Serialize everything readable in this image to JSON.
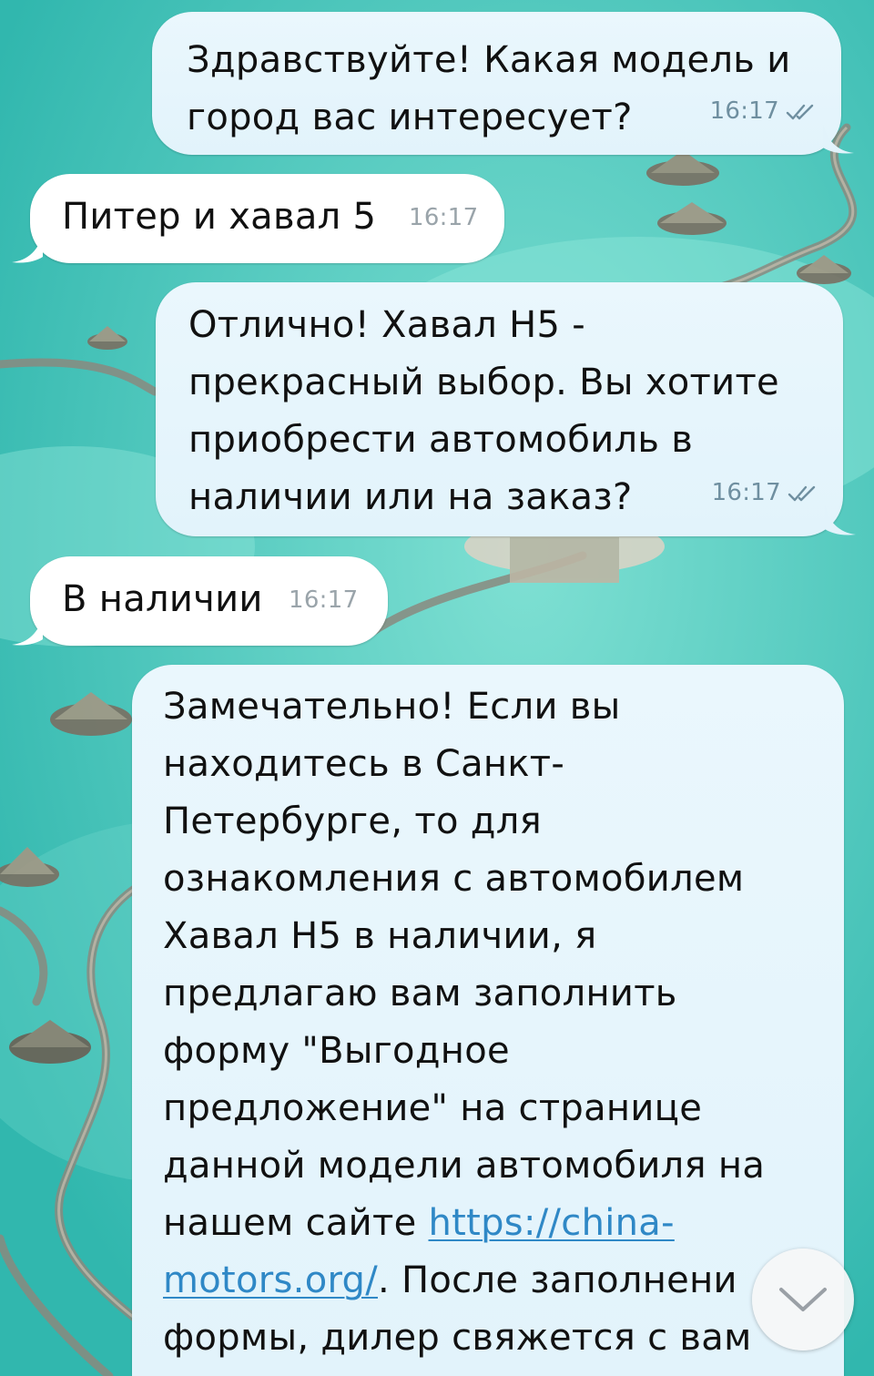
{
  "messages": [
    {
      "id": "m1",
      "direction": "outgoing",
      "lines": [
        "Здравствуйте! Какая модель и",
        "город вас интересует?"
      ],
      "time": "16:17",
      "status": "read"
    },
    {
      "id": "m2",
      "direction": "incoming",
      "text": "Питер и хавал 5",
      "time": "16:17"
    },
    {
      "id": "m3",
      "direction": "outgoing",
      "lines": [
        "Отлично! Хавал Н5 -",
        "прекрасный выбор. Вы хотите",
        "приобрести автомобиль в",
        "наличии или на заказ?"
      ],
      "time": "16:17",
      "status": "read"
    },
    {
      "id": "m4",
      "direction": "incoming",
      "text": "В наличии",
      "time": "16:17"
    },
    {
      "id": "m5",
      "direction": "outgoing",
      "lines": [
        "Замечательно! Если вы",
        "находитесь в Санкт-",
        "Петербурге, то для",
        "ознакомления с автомобилем",
        "Хавал Н5 в наличии, я",
        "предлагаю вам заполнить",
        "форму \"Выгодное",
        "предложение\" на странице",
        "данной модели автомобиля на"
      ],
      "link_prefix": "нашем сайте ",
      "link_part1": "https://china-",
      "link_part2": "motors.org/",
      "after_link": ". После заполнени",
      "last_line": "формы, дилер свяжется с вам"
    }
  ],
  "icons": {
    "read_status": "double-check-icon",
    "scroll_down": "chevron-down-icon"
  },
  "colors": {
    "outgoing_bubble": "#e2f3fb",
    "incoming_bubble": "#ffffff",
    "link": "#2f88c6",
    "meta_out": "#6f8fa0",
    "meta_in": "#9aa4aa"
  }
}
